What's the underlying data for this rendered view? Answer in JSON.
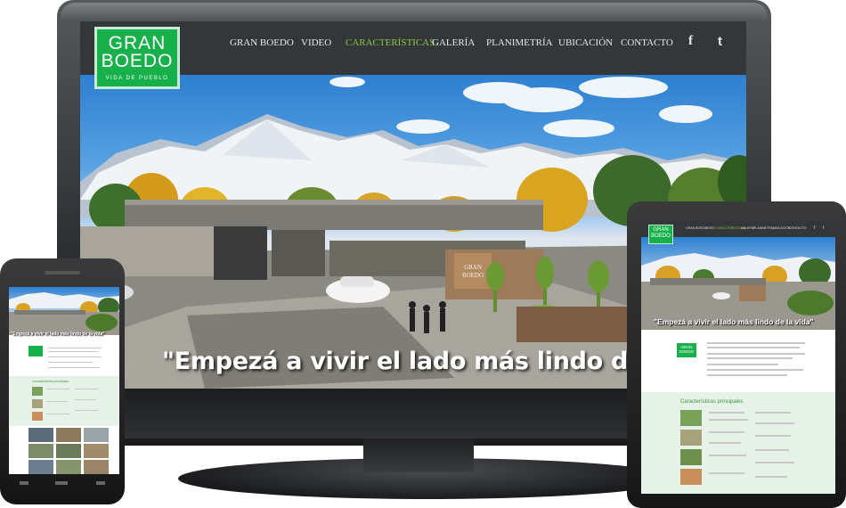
{
  "desktop": {
    "logo": {
      "line1": "GRAN",
      "line2": "BOEDO",
      "tagline": "VIDA DE PUEBLO"
    },
    "nav": [
      {
        "label": "GRAN BOEDO",
        "active": false
      },
      {
        "label": "VIDEO",
        "active": false
      },
      {
        "label": "CARACTERÍSTICAS",
        "active": true
      },
      {
        "label": "GALERÍA",
        "active": false
      },
      {
        "label": "PLANIMETRÍA",
        "active": false
      },
      {
        "label": "UBICACIÓN",
        "active": false
      },
      {
        "label": "CONTACTO",
        "active": false
      }
    ],
    "social": {
      "facebook": "f",
      "twitter": "t"
    },
    "hero_caption": "\"Empezá a vivir el lado más lindo de la vid",
    "entrance_sign": "GRAN BOEDO"
  },
  "tablet": {
    "logo": {
      "line1": "GRAN",
      "line2": "BOEDO"
    },
    "nav": [
      "GRAN BOEDO",
      "VIDEO",
      "CARACTERÍSTICAS",
      "GALERÍA",
      "PLANIMETRÍA",
      "UBICACIÓN",
      "CONTACTO"
    ],
    "hero_caption": "\"Empezá a vivir el lado más lindo de la vida\"",
    "info_logo": {
      "line1": "GRAN",
      "line2": "BOEDO"
    },
    "features_title": "Características principales"
  },
  "phone": {
    "hero_caption": "\"Empezá a vivir el lado más lindo de la vida\"",
    "features_title": "Características principales"
  },
  "colors": {
    "brand_green": "#17b04a",
    "nav_active": "#8cc63f",
    "header_bg": "#343739",
    "features_bg": "#e6f1e8"
  }
}
